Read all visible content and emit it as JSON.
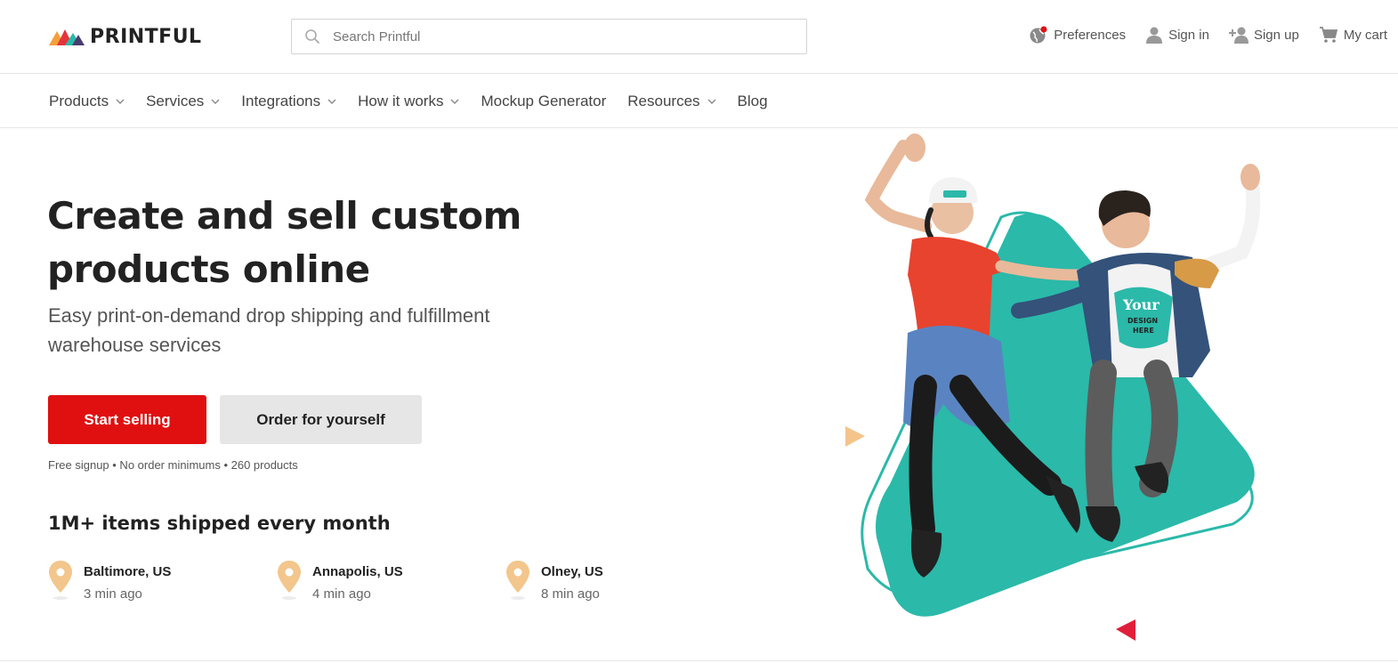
{
  "brand": {
    "name": "PRINTFUL"
  },
  "search": {
    "placeholder": "Search Printful",
    "value": ""
  },
  "utilities": {
    "preferences": "Preferences",
    "sign_in": "Sign in",
    "sign_up": "Sign up",
    "cart": "My cart"
  },
  "nav": {
    "items": [
      {
        "label": "Products",
        "dropdown": true
      },
      {
        "label": "Services",
        "dropdown": true
      },
      {
        "label": "Integrations",
        "dropdown": true
      },
      {
        "label": "How it works",
        "dropdown": true
      },
      {
        "label": "Mockup Generator",
        "dropdown": false
      },
      {
        "label": "Resources",
        "dropdown": true
      },
      {
        "label": "Blog",
        "dropdown": false
      }
    ]
  },
  "hero": {
    "title_line1": "Create and sell custom",
    "title_line2": "products online",
    "subtitle_line1": "Easy print-on-demand drop shipping and fulfillment",
    "subtitle_line2": "warehouse services",
    "primary_cta": "Start selling",
    "secondary_cta": "Order for yourself",
    "note": "Free signup • No order minimums • 260 products",
    "shirt_text_1": "Your",
    "shirt_text_2": "DESIGN",
    "shirt_text_3": "HERE"
  },
  "shipping": {
    "title": "1M+ items shipped every month",
    "orders": [
      {
        "city": "Baltimore, US",
        "time": "3 min ago"
      },
      {
        "city": "Annapolis, US",
        "time": "4 min ago"
      },
      {
        "city": "Olney, US",
        "time": "8 min ago"
      }
    ]
  },
  "colors": {
    "primary_red": "#e01010",
    "teal": "#2bb9a9",
    "pin": "#f2c68c",
    "accent_yellow": "#f5c48a",
    "accent_red": "#e0203a"
  },
  "icons": {
    "search": "search-icon",
    "preferences": "globe-icon",
    "sign_in": "user-icon",
    "sign_up": "add-user-icon",
    "cart": "cart-icon",
    "dropdown": "chevron-down-icon",
    "location": "map-pin-icon"
  }
}
